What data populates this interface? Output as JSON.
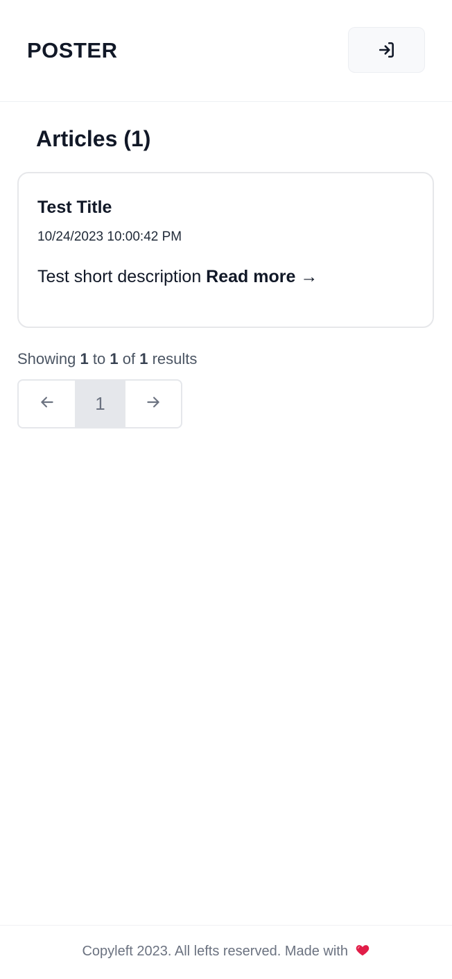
{
  "header": {
    "brand": "POSTER",
    "login_icon": "login-icon"
  },
  "main": {
    "title": "Articles (1)",
    "articles": [
      {
        "title": "Test Title",
        "date": "10/24/2023 10:00:42 PM",
        "description": "Test short description",
        "read_more": "Read more →"
      }
    ]
  },
  "pagination": {
    "showing": "Showing",
    "from": "1",
    "to_word": "to",
    "to": "1",
    "of_word": "of",
    "total": "1",
    "results_word": "results",
    "current_page": "1",
    "prev_icon": "arrow-left-icon",
    "next_icon": "arrow-right-icon"
  },
  "footer": {
    "text": "Copyleft 2023. All lefts reserved. Made with",
    "heart_icon": "heart-icon",
    "heart_color": "#e11d48"
  }
}
